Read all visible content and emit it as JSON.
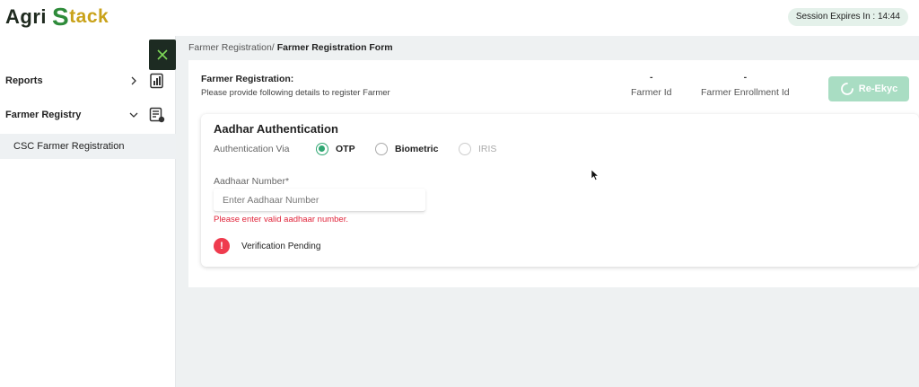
{
  "header": {
    "logo_word1": "Agri",
    "logo_s": "S",
    "logo_word2": "tack",
    "session_text": "Session Expires In : 14:44"
  },
  "sidebar": {
    "items": [
      {
        "label": "Reports",
        "icon": "report-chart-icon"
      },
      {
        "label": "Farmer Registry",
        "icon": "registry-list-icon"
      }
    ],
    "sub_items": [
      {
        "label": "CSC Farmer Registration"
      }
    ]
  },
  "breadcrumb": {
    "parent": "Farmer Registration/",
    "current": "Farmer Registration Form"
  },
  "registration": {
    "title": "Farmer Registration:",
    "description": "Please provide following details to register Farmer",
    "farmer_id_value": "-",
    "farmer_id_label": "Farmer Id",
    "enrollment_id_value": "-",
    "enrollment_id_label": "Farmer Enrollment Id",
    "rekyc_label": "Re-Ekyc"
  },
  "auth": {
    "title": "Aadhar Authentication",
    "via_label": "Authentication Via",
    "options": [
      {
        "label": "OTP",
        "selected": true,
        "disabled": false
      },
      {
        "label": "Biometric",
        "selected": false,
        "disabled": false
      },
      {
        "label": "IRIS",
        "selected": false,
        "disabled": true
      }
    ],
    "aadhaar_label": "Aadhaar Number*",
    "aadhaar_value": "",
    "aadhaar_placeholder": "Enter Aadhaar Number",
    "aadhaar_error": "Please enter valid aadhaar number.",
    "verify_icon_glyph": "!",
    "verify_status": "Verification Pending"
  },
  "colors": {
    "accent": "#2fa772",
    "error": "#e0243a",
    "rekyc_disabled": "#a9ddc3",
    "sidebar_close_bg": "#1d2b22"
  }
}
